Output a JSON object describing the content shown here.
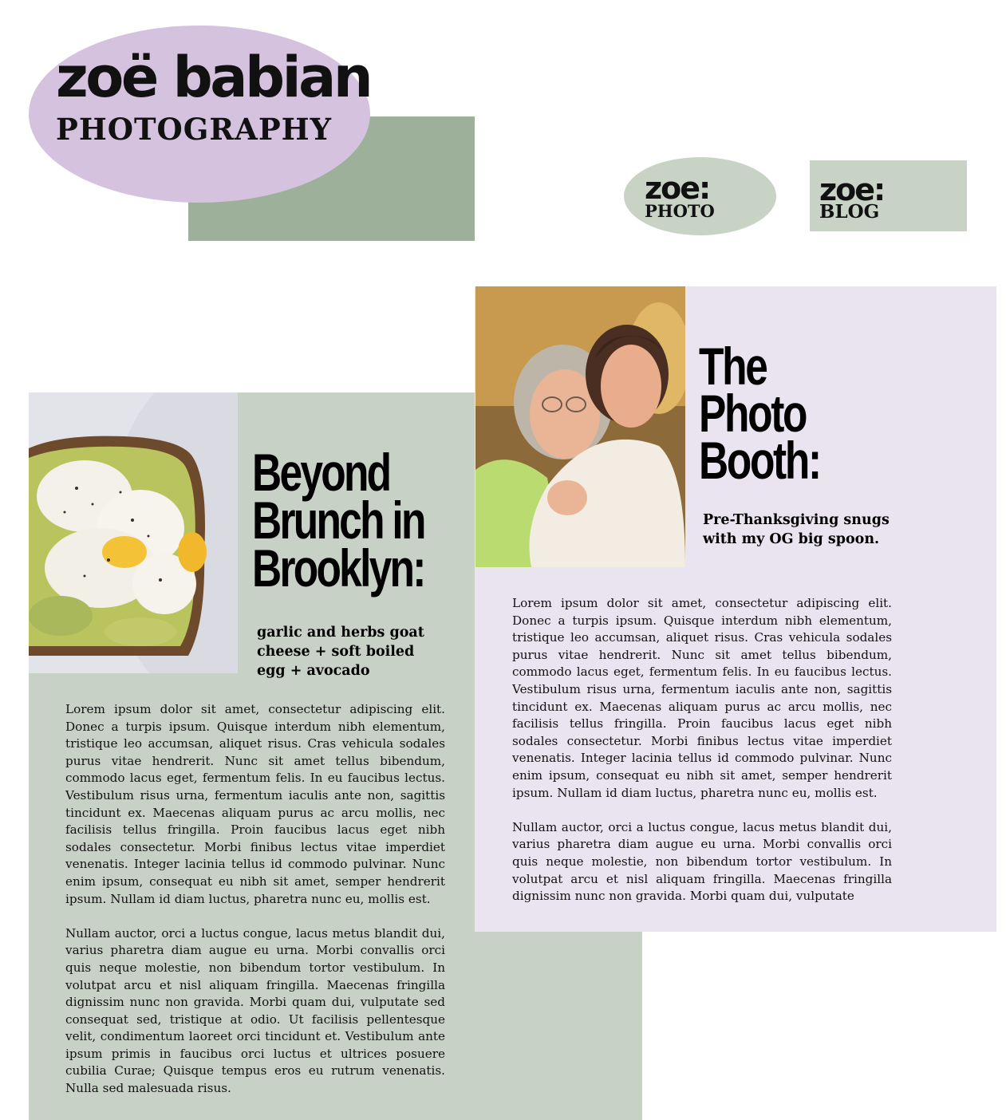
{
  "logo": {
    "name": "zoë babian",
    "subtitle": "PHOTOGRAPHY"
  },
  "nav": {
    "photo": {
      "top": "zoe:",
      "bottom": "PHOTO"
    },
    "blog": {
      "top": "zoe:",
      "bottom": "BLOG"
    }
  },
  "article_brunch": {
    "title_lines": [
      "Beyond",
      "Brunch in",
      "Brooklyn:"
    ],
    "subtitle": "garlic and herbs goat cheese + soft boiled egg + avocado",
    "image_icon": "avocado-toast-photo",
    "paragraphs": [
      "Lorem ipsum dolor sit amet, consectetur adipiscing elit. Donec a turpis ipsum. Quisque interdum nibh elementum, tristique leo accumsan, aliquet risus. Cras vehicula sodales purus vitae hendrerit. Nunc sit amet tellus bibendum, commodo lacus eget, fermentum felis. In eu faucibus lectus. Vestibulum risus urna, fermentum iaculis ante non, sagittis tincidunt ex. Maecenas aliquam purus ac arcu mollis, nec facilisis tellus fringilla. Proin faucibus lacus eget nibh sodales consectetur. Morbi finibus lectus vitae imperdiet venenatis. Integer lacinia tellus id commodo pulvinar. Nunc enim ipsum, consequat eu nibh sit amet, semper hendrerit ipsum. Nullam id diam luctus, pharetra nunc eu, mollis est.",
      "Nullam auctor, orci a luctus congue, lacus metus blandit dui, varius pharetra diam augue eu urna. Morbi convallis orci quis neque molestie, non bibendum tortor vestibulum. In volutpat arcu et nisl aliquam fringilla. Maecenas fringilla dignissim nunc non gravida. Morbi quam dui, vulputate sed consequat sed, tristique at odio. Ut facilisis pellentesque velit, condimentum laoreet orci tincidunt et. Vestibulum ante ipsum primis in faucibus orci luctus et ultrices posuere cubilia Curae; Quisque tempus eros eu rutrum venenatis. Nulla sed malesuada risus."
    ]
  },
  "article_booth": {
    "title_lines": [
      "The",
      "Photo",
      "Booth:"
    ],
    "subtitle": "Pre-Thanksgiving snugs with my OG big spoon.",
    "image_icon": "two-women-selfie-photo",
    "paragraphs": [
      "Lorem ipsum dolor sit amet, consectetur adipiscing elit. Donec a turpis ipsum. Quisque interdum nibh elementum, tristique leo accumsan, aliquet risus. Cras vehicula sodales purus vitae hendrerit. Nunc sit amet tellus bibendum, commodo lacus eget, fermentum felis. In eu faucibus lectus. Vestibulum risus urna, fermentum iaculis ante non, sagittis tincidunt ex. Maecenas aliquam purus ac arcu mollis, nec facilisis tellus fringilla. Proin faucibus lacus eget nibh sodales consectetur. Morbi finibus lectus vitae imperdiet venenatis. Integer lacinia tellus id commodo pulvinar. Nunc enim ipsum, consequat eu nibh sit amet, semper hendrerit ipsum. Nullam id diam luctus, pharetra nunc eu, mollis est.",
      "Nullam auctor, orci a luctus congue, lacus metus blandit dui, varius pharetra diam augue eu urna. Morbi convallis orci quis neque molestie, non bibendum tortor vestibulum. In volutpat arcu et nisl aliquam fringilla. Maecenas fringilla dignissim nunc non gravida. Morbi quam dui, vulputate"
    ]
  },
  "colors": {
    "lavender": "#d4c2de",
    "sage": "#9db19a",
    "pale_sage": "#c8d1c6",
    "pale_lavender": "#e9e4ef"
  }
}
